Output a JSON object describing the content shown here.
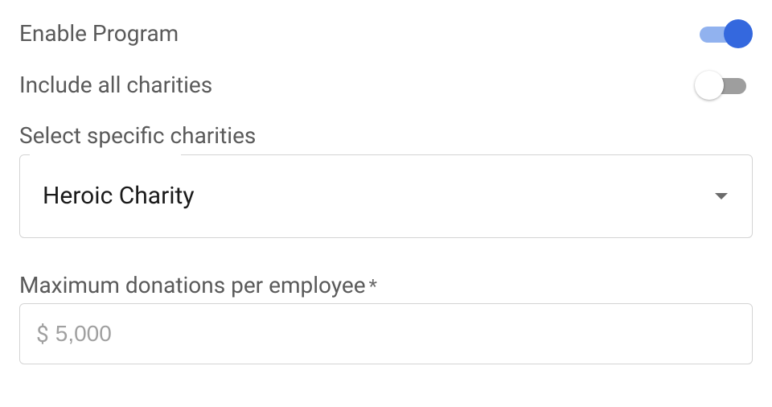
{
  "toggles": {
    "enable_program": {
      "label": "Enable Program",
      "state": "on"
    },
    "include_all_charities": {
      "label": "Include all charities",
      "state": "off"
    }
  },
  "charity_select": {
    "label": "Select specific charities",
    "value": "Heroic Charity"
  },
  "max_donation": {
    "label": "Maximum donations per employee",
    "asterisk": "*",
    "prefix": "$",
    "value": "5,000"
  }
}
